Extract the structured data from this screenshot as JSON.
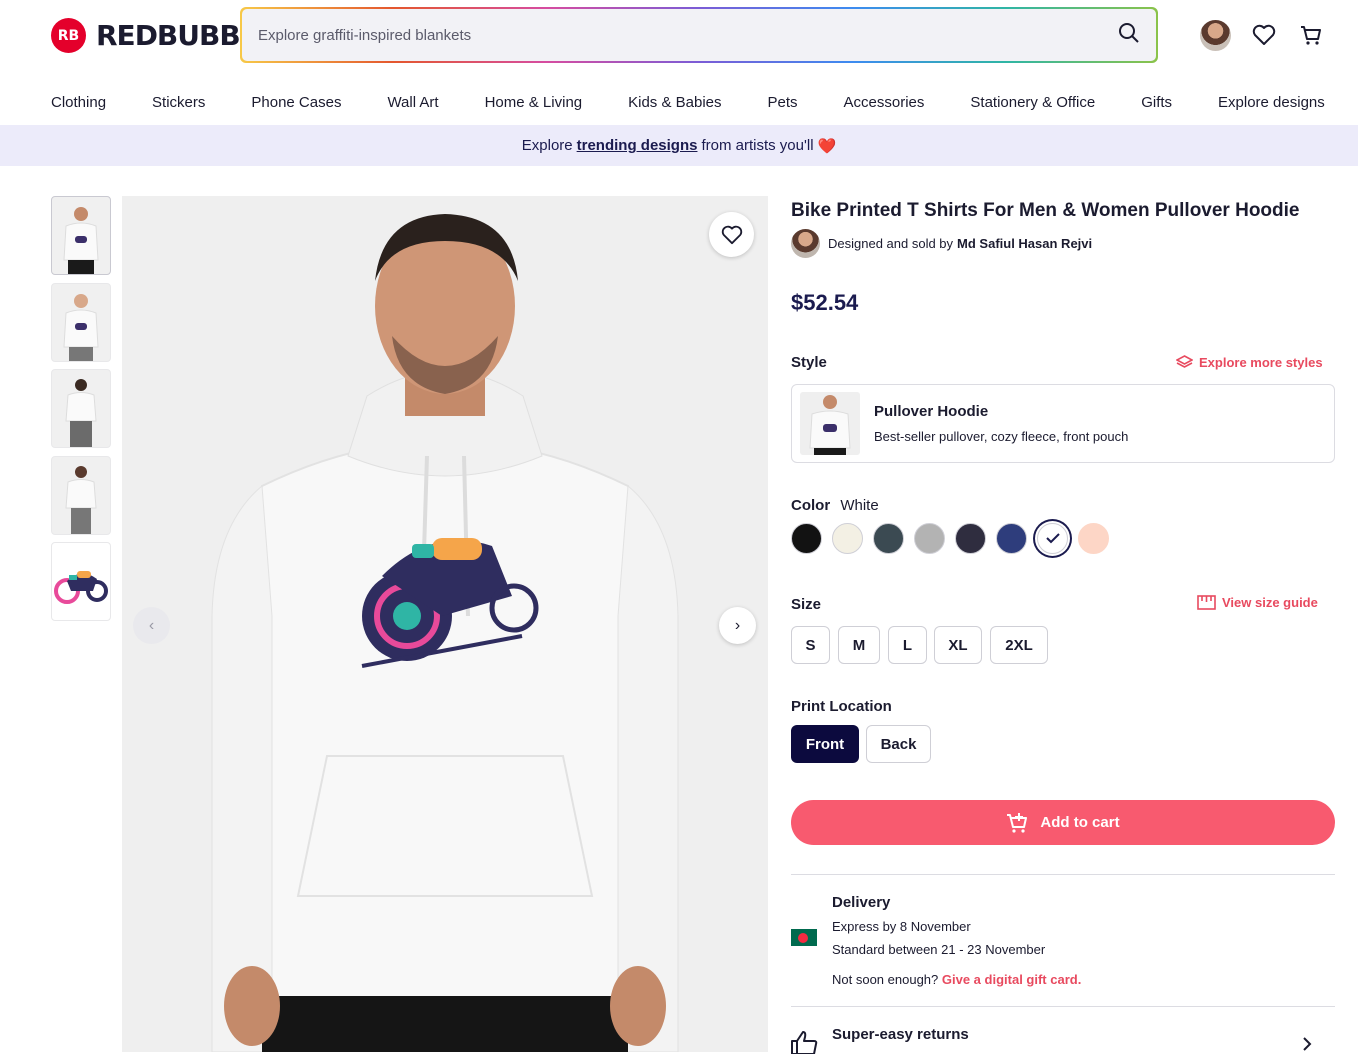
{
  "brand": {
    "mark": "RB",
    "name": "REDBUBBLE"
  },
  "search": {
    "placeholder": "Explore graffiti-inspired blankets"
  },
  "nav": [
    "Clothing",
    "Stickers",
    "Phone Cases",
    "Wall Art",
    "Home & Living",
    "Kids & Babies",
    "Pets",
    "Accessories",
    "Stationery & Office",
    "Gifts",
    "Explore designs"
  ],
  "banner": {
    "prefix": "Explore",
    "link": "trending designs",
    "suffix": "from artists you'll",
    "heart": "❤️"
  },
  "product": {
    "title": "Bike Printed T Shirts For Men & Women Pullover Hoodie",
    "seller_prefix": "Designed and sold by",
    "seller_name": "Md Safiul Hasan Rejvi",
    "price": "$52.54"
  },
  "style": {
    "label": "Style",
    "explore_link": "Explore more styles",
    "card_title": "Pullover Hoodie",
    "card_desc": "Best-seller pullover, cozy fleece, front pouch"
  },
  "color": {
    "label": "Color",
    "selected": "White",
    "swatches": [
      "#121212",
      "#f3f0e4",
      "#3b4a52",
      "#b3b3b3",
      "#2f2d3f",
      "#2e3d7c",
      "#ffffff",
      "#fdd6c6"
    ],
    "selected_index": 6
  },
  "size": {
    "label": "Size",
    "guide_link": "View size guide",
    "options": [
      "S",
      "M",
      "L",
      "XL",
      "2XL"
    ]
  },
  "print_location": {
    "label": "Print Location",
    "options": [
      "Front",
      "Back"
    ],
    "selected": "Front"
  },
  "cart": {
    "label": "Add to cart"
  },
  "delivery": {
    "title": "Delivery",
    "express": "Express by 8 November",
    "standard": "Standard between 21 - 23 November",
    "gift_prefix": "Not soon enough?",
    "gift_link": "Give a digital gift card."
  },
  "returns": {
    "title": "Super-easy returns"
  },
  "colors": {
    "accent": "#f85a6f",
    "link_red": "#e84a5f",
    "navy": "#0c0a3e",
    "banner_bg": "#ecebfa"
  }
}
